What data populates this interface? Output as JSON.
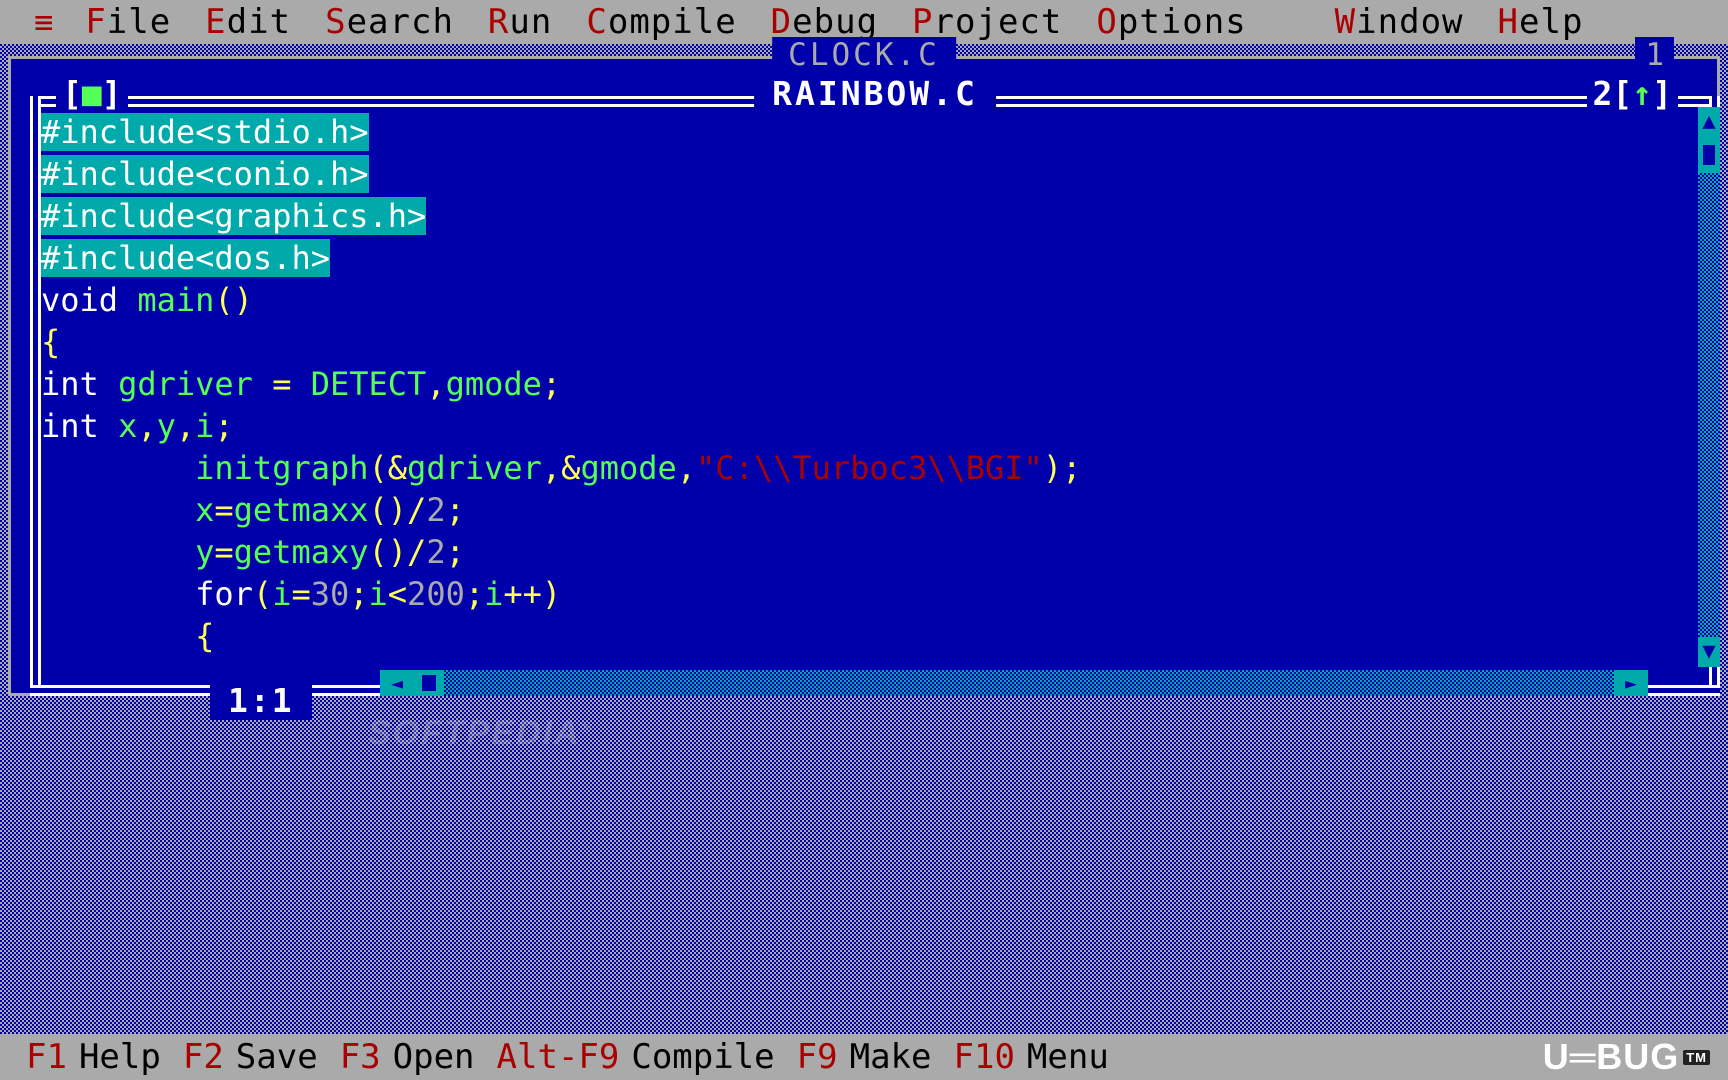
{
  "menubar": {
    "logo_icon": "hamburger-menu-icon",
    "logo_glyph": "≡",
    "items": [
      {
        "hot": "F",
        "rest": "ile",
        "label": "File"
      },
      {
        "hot": "E",
        "rest": "dit",
        "label": "Edit"
      },
      {
        "hot": "S",
        "rest": "earch",
        "label": "Search"
      },
      {
        "hot": "R",
        "rest": "un",
        "label": "Run"
      },
      {
        "hot": "C",
        "rest": "ompile",
        "label": "Compile"
      },
      {
        "hot": "D",
        "rest": "ebug",
        "label": "Debug"
      },
      {
        "hot": "P",
        "rest": "roject",
        "label": "Project"
      },
      {
        "hot": "O",
        "rest": "ptions",
        "label": "Options"
      },
      {
        "hot": "W",
        "rest": "indow",
        "label": "Window"
      },
      {
        "hot": "H",
        "rest": "elp",
        "label": "Help"
      }
    ]
  },
  "background_window": {
    "title": "CLOCK.C",
    "number": "1"
  },
  "active_window": {
    "title": "RAINBOW.C",
    "number": "2",
    "close_box_left": "[",
    "close_box_mark": "■",
    "close_box_right": "]",
    "zoom_box_left": "[",
    "zoom_box_mark": "↑",
    "zoom_box_right": "]",
    "cursor_position": "1:1"
  },
  "editor": {
    "lines": [
      {
        "selected": true,
        "tokens": [
          {
            "t": "#include<stdio.h>",
            "c": "pl"
          }
        ]
      },
      {
        "selected": true,
        "tokens": [
          {
            "t": "#include<conio.h>",
            "c": "pl"
          }
        ]
      },
      {
        "selected": true,
        "tokens": [
          {
            "t": "#include<graphics.h>",
            "c": "pl"
          }
        ]
      },
      {
        "selected": true,
        "tokens": [
          {
            "t": "#include<dos.h>",
            "c": "pl"
          }
        ]
      },
      {
        "selected": false,
        "tokens": [
          {
            "t": "void",
            "c": "kw"
          },
          {
            "t": " ",
            "c": "pl"
          },
          {
            "t": "main",
            "c": "id"
          },
          {
            "t": "()",
            "c": "op"
          }
        ]
      },
      {
        "selected": false,
        "tokens": [
          {
            "t": "{",
            "c": "op"
          }
        ]
      },
      {
        "selected": false,
        "tokens": [
          {
            "t": "int",
            "c": "kw"
          },
          {
            "t": " ",
            "c": "pl"
          },
          {
            "t": "gdriver",
            "c": "id"
          },
          {
            "t": " ",
            "c": "pl"
          },
          {
            "t": "=",
            "c": "op"
          },
          {
            "t": " ",
            "c": "pl"
          },
          {
            "t": "DETECT",
            "c": "id"
          },
          {
            "t": ",",
            "c": "op"
          },
          {
            "t": "gmode",
            "c": "id"
          },
          {
            "t": ";",
            "c": "op"
          }
        ]
      },
      {
        "selected": false,
        "tokens": [
          {
            "t": "int",
            "c": "kw"
          },
          {
            "t": " ",
            "c": "pl"
          },
          {
            "t": "x",
            "c": "id"
          },
          {
            "t": ",",
            "c": "op"
          },
          {
            "t": "y",
            "c": "id"
          },
          {
            "t": ",",
            "c": "op"
          },
          {
            "t": "i",
            "c": "id"
          },
          {
            "t": ";",
            "c": "op"
          }
        ]
      },
      {
        "selected": false,
        "tokens": [
          {
            "t": "        ",
            "c": "pl"
          },
          {
            "t": "initgraph",
            "c": "id"
          },
          {
            "t": "(",
            "c": "op"
          },
          {
            "t": "&",
            "c": "op"
          },
          {
            "t": "gdriver",
            "c": "id"
          },
          {
            "t": ",",
            "c": "op"
          },
          {
            "t": "&",
            "c": "op"
          },
          {
            "t": "gmode",
            "c": "id"
          },
          {
            "t": ",",
            "c": "op"
          },
          {
            "t": "\"C:\\\\Turboc3\\\\BGI\"",
            "c": "str"
          },
          {
            "t": ");",
            "c": "op"
          }
        ]
      },
      {
        "selected": false,
        "tokens": [
          {
            "t": "        ",
            "c": "pl"
          },
          {
            "t": "x",
            "c": "id"
          },
          {
            "t": "=",
            "c": "op"
          },
          {
            "t": "getmaxx",
            "c": "id"
          },
          {
            "t": "()",
            "c": "op"
          },
          {
            "t": "/",
            "c": "op"
          },
          {
            "t": "2",
            "c": "num"
          },
          {
            "t": ";",
            "c": "op"
          }
        ]
      },
      {
        "selected": false,
        "tokens": [
          {
            "t": "        ",
            "c": "pl"
          },
          {
            "t": "y",
            "c": "id"
          },
          {
            "t": "=",
            "c": "op"
          },
          {
            "t": "getmaxy",
            "c": "id"
          },
          {
            "t": "()",
            "c": "op"
          },
          {
            "t": "/",
            "c": "op"
          },
          {
            "t": "2",
            "c": "num"
          },
          {
            "t": ";",
            "c": "op"
          }
        ]
      },
      {
        "selected": false,
        "tokens": [
          {
            "t": "        ",
            "c": "pl"
          },
          {
            "t": "for",
            "c": "kw"
          },
          {
            "t": "(",
            "c": "op"
          },
          {
            "t": "i",
            "c": "id"
          },
          {
            "t": "=",
            "c": "op"
          },
          {
            "t": "30",
            "c": "num"
          },
          {
            "t": ";",
            "c": "op"
          },
          {
            "t": "i",
            "c": "id"
          },
          {
            "t": "<",
            "c": "op"
          },
          {
            "t": "200",
            "c": "num"
          },
          {
            "t": ";",
            "c": "op"
          },
          {
            "t": "i",
            "c": "id"
          },
          {
            "t": "++",
            "c": "op"
          },
          {
            "t": ")",
            "c": "op"
          }
        ]
      },
      {
        "selected": false,
        "tokens": [
          {
            "t": "        ",
            "c": "pl"
          },
          {
            "t": "{",
            "c": "op"
          }
        ]
      }
    ]
  },
  "scrollbars": {
    "vertical": {
      "up_icon": "triangle-up-icon",
      "up_glyph": "▲",
      "down_icon": "triangle-down-icon",
      "down_glyph": "▼"
    },
    "horizontal": {
      "left_icon": "triangle-left-icon",
      "left_glyph": "◄",
      "right_icon": "triangle-right-icon",
      "right_glyph": "►"
    }
  },
  "watermark": {
    "text": "SOFTPEDIA",
    "mark": "®"
  },
  "statusbar": {
    "items": [
      {
        "key": "F1",
        "label": "Help"
      },
      {
        "key": "F2",
        "label": "Save"
      },
      {
        "key": "F3",
        "label": "Open"
      },
      {
        "key": "Alt-F9",
        "label": "Compile"
      },
      {
        "key": "F9",
        "label": "Make"
      },
      {
        "key": "F10",
        "label": "Menu"
      }
    ],
    "brand": "U═BUG",
    "brand_badge": "TM"
  },
  "colors": {
    "desktop_blue": "#0000aa",
    "bar_gray": "#aaaaaa",
    "hotkey_red": "#aa0000",
    "selection_cyan": "#00aaaa",
    "identifier_green": "#55ff55",
    "operator_yellow": "#ffff55",
    "number_gray": "#aaaaaa",
    "string_red": "#aa0000",
    "accent_green": "#55ff55"
  }
}
